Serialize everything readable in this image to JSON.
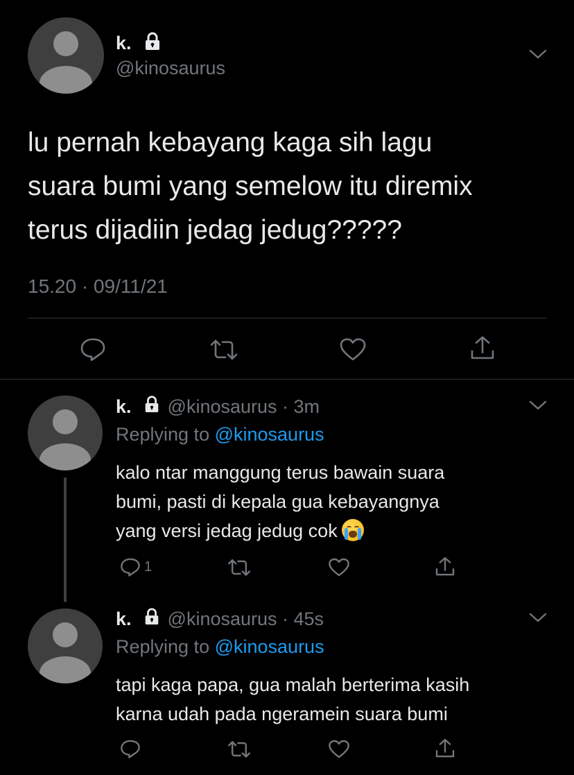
{
  "main_tweet": {
    "author_name": "k.",
    "handle": "@kinosaurus",
    "text_lines": [
      "lu pernah kebayang kaga sih lagu",
      "suara bumi yang semelow itu diremix",
      "terus dijadiin jedag jedug?????"
    ],
    "timestamp": "15.20 · 09/11/21"
  },
  "replies": [
    {
      "author_name": "k.",
      "handle_time": "@kinosaurus · 3m",
      "replying_label": "Replying to ",
      "replying_handle": "@kinosaurus",
      "text_lines": [
        "kalo ntar manggung terus bawain suara",
        "bumi, pasti di kepala gua kebayangnya",
        "yang versi jedag jedug cok"
      ],
      "emoji": "loudly-crying-face",
      "reply_count": "1"
    },
    {
      "author_name": "k.",
      "handle_time": "@kinosaurus · 45s",
      "replying_label": "Replying to ",
      "replying_handle": "@kinosaurus",
      "text_lines": [
        "tapi kaga papa, gua malah berterima kasih",
        "karna udah pada ngeramein suara bumi"
      ],
      "reply_count": ""
    }
  ],
  "icons": {
    "protected": "lock-icon",
    "menu": "chevron-down-icon",
    "reply": "comment-icon",
    "retweet": "retweet-icon",
    "like": "heart-icon",
    "share": "share-icon"
  },
  "colors": {
    "background": "#000000",
    "text": "#e7e9ea",
    "muted": "#71767b",
    "link": "#1d9bf0",
    "divider": "#2f3336"
  }
}
